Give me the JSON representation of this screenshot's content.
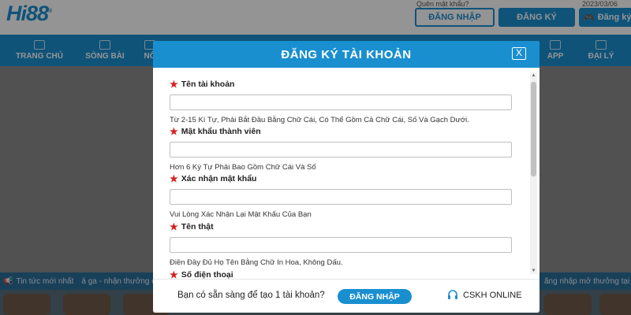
{
  "header": {
    "logo_text": "Hi88",
    "logo_mark": "®",
    "forgot_password": "Quên mật khẩu?",
    "date_text": "2023/03/06",
    "login_button": "ĐĂNG NHẬP",
    "register_button": "ĐĂNG KÝ",
    "register_game_button": "Đăng ký"
  },
  "nav": {
    "items": [
      {
        "label": "TRANG CHỦ",
        "icon": "home-icon"
      },
      {
        "label": "SÒNG BÀI",
        "icon": "casino-icon"
      },
      {
        "label": "NỔ",
        "icon": "slot-icon"
      },
      {
        "label": "APP",
        "icon": "app-icon"
      },
      {
        "label": "ĐẠI LÝ",
        "icon": "agent-icon"
      }
    ]
  },
  "ticker": {
    "label": "Tin tức mới nhất",
    "text_left": "ả ga - nhận thưởng c",
    "text_right": "ăng nhập mở thưởng tại hôm"
  },
  "modal": {
    "title": "ĐĂNG KÝ TÀI KHOẢN",
    "close_label": "X",
    "fields": [
      {
        "label": "Tên tài khoản",
        "value": "",
        "hint": "Từ 2-15 Kí Tự, Phải Bắt Đầu Bằng Chữ Cái, Có Thể Gồm Cả Chữ Cái, Số Và Gạch Dưới."
      },
      {
        "label": "Mật khẩu thành viên",
        "value": "",
        "hint": "Hơn 6 Ký Tự Phải Bao Gồm Chữ Cái Và Số"
      },
      {
        "label": "Xác nhận mật khẩu",
        "value": "",
        "hint": "Vui Lòng Xác Nhận Lại Mật Khẩu Của Bạn"
      },
      {
        "label": "Tên thật",
        "value": "",
        "hint": "Điền Đầy Đủ Họ Tên Bằng Chữ In Hoa, Không Dấu."
      },
      {
        "label": "Số điện thoại",
        "value": "",
        "hint": ""
      }
    ],
    "footer": {
      "question": "Bạn có sẵn sàng để tạo 1 tài khoản?",
      "login_button": "ĐĂNG NHẬP",
      "support_label": "CSKH ONLINE"
    }
  },
  "colors": {
    "brand_blue": "#1a8fd0",
    "required_star": "#d81e1e"
  }
}
